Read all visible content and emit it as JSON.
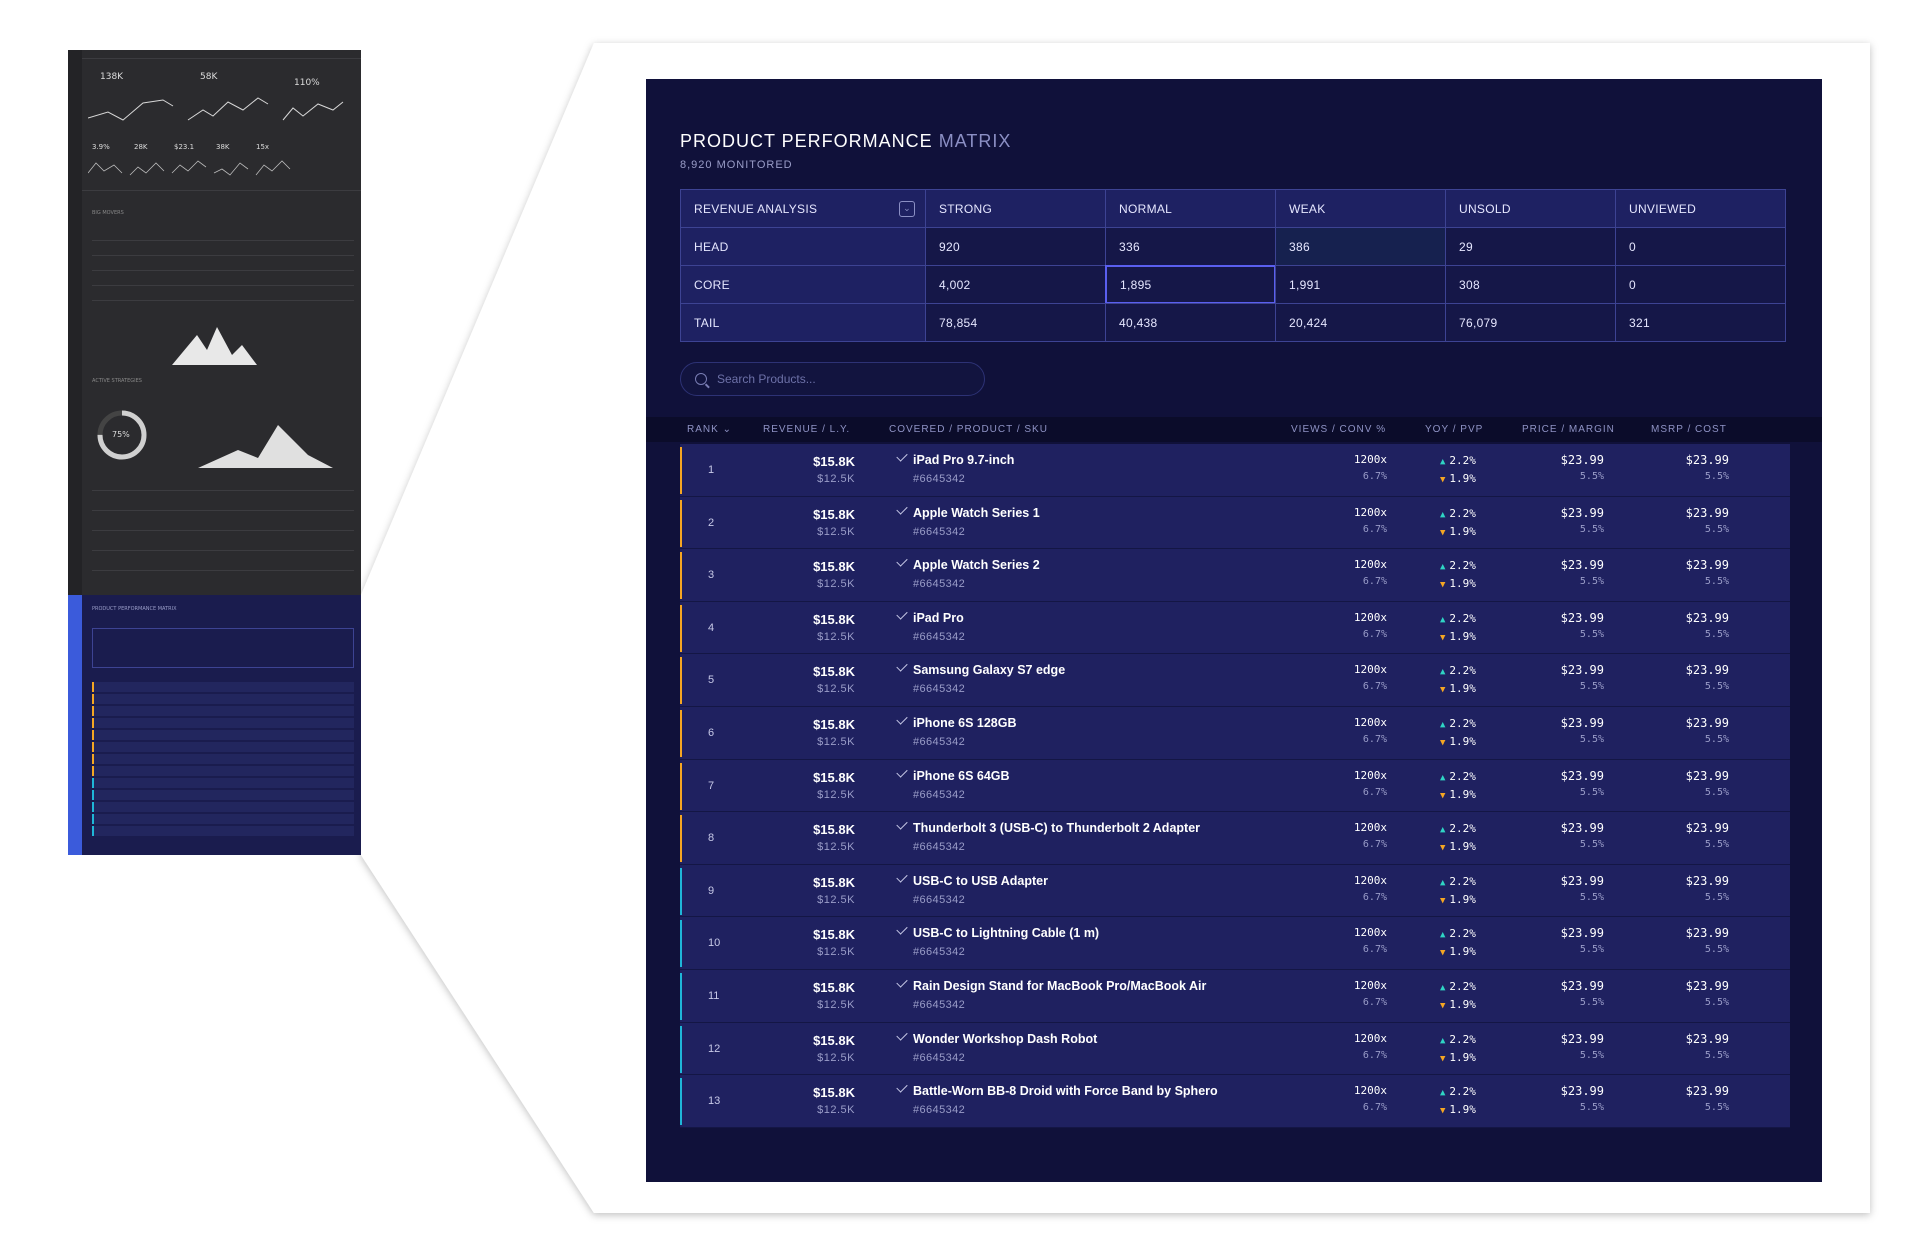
{
  "thumbnail": {
    "kpis": [
      "138K",
      "58K",
      "110%"
    ],
    "mini_kpis": [
      "3.9%",
      "28K",
      "$23.1",
      "38K",
      "15x"
    ],
    "section_big_movers": "BIG MOVERS",
    "section_active_strategies": "ACTIVE STRATEGIES",
    "donut_value": "75%",
    "section_product_performance": "PRODUCT PERFORMANCE MATRIX"
  },
  "matrix_panel": {
    "title_main": "PRODUCT PERFORMANCE",
    "title_dim": "MATRIX",
    "subtitle": "8,920 MONITORED",
    "header": [
      "REVENUE ANALYSIS",
      "STRONG",
      "NORMAL",
      "WEAK",
      "UNSOLD",
      "UNVIEWED"
    ],
    "rows": [
      {
        "label": "HEAD",
        "values": [
          "920",
          "336",
          "386",
          "29",
          "0"
        ]
      },
      {
        "label": "CORE",
        "values": [
          "4,002",
          "1,895",
          "1,991",
          "308",
          "0"
        ]
      },
      {
        "label": "TAIL",
        "values": [
          "78,854",
          "40,438",
          "20,424",
          "76,079",
          "321"
        ]
      }
    ],
    "colors": {
      "panel_bg": "#10113a",
      "selected_border": "#5a5ff0",
      "accent_orange": "#f5a623",
      "accent_cyan": "#1fb6d8"
    }
  },
  "search": {
    "placeholder": "Search Products..."
  },
  "table": {
    "headers": {
      "rank": "RANK",
      "revenue": "REVENUE / L.Y.",
      "product": "COVERED / PRODUCT / SKU",
      "views": "VIEWS / CONV %",
      "yoy": "YOY / PVP",
      "price": "PRICE / MARGIN",
      "msrp": "MSRP / COST"
    },
    "rows": [
      {
        "rank": "1",
        "revenue": "$15.8K",
        "ly": "$12.5K",
        "name": "iPad Pro 9.7-inch",
        "sku": "#6645342",
        "views": "1200x",
        "conv": "6.7%",
        "yoy": "2.2%",
        "pvp": "1.9%",
        "price": "$23.99",
        "margin": "5.5%",
        "msrp": "$23.99",
        "cost": "5.5%",
        "accent": "orange"
      },
      {
        "rank": "2",
        "revenue": "$15.8K",
        "ly": "$12.5K",
        "name": "Apple Watch Series 1",
        "sku": "#6645342",
        "views": "1200x",
        "conv": "6.7%",
        "yoy": "2.2%",
        "pvp": "1.9%",
        "price": "$23.99",
        "margin": "5.5%",
        "msrp": "$23.99",
        "cost": "5.5%",
        "accent": "orange"
      },
      {
        "rank": "3",
        "revenue": "$15.8K",
        "ly": "$12.5K",
        "name": "Apple Watch Series 2",
        "sku": "#6645342",
        "views": "1200x",
        "conv": "6.7%",
        "yoy": "2.2%",
        "pvp": "1.9%",
        "price": "$23.99",
        "margin": "5.5%",
        "msrp": "$23.99",
        "cost": "5.5%",
        "accent": "orange"
      },
      {
        "rank": "4",
        "revenue": "$15.8K",
        "ly": "$12.5K",
        "name": "iPad Pro",
        "sku": "#6645342",
        "views": "1200x",
        "conv": "6.7%",
        "yoy": "2.2%",
        "pvp": "1.9%",
        "price": "$23.99",
        "margin": "5.5%",
        "msrp": "$23.99",
        "cost": "5.5%",
        "accent": "orange"
      },
      {
        "rank": "5",
        "revenue": "$15.8K",
        "ly": "$12.5K",
        "name": "Samsung Galaxy S7 edge",
        "sku": "#6645342",
        "views": "1200x",
        "conv": "6.7%",
        "yoy": "2.2%",
        "pvp": "1.9%",
        "price": "$23.99",
        "margin": "5.5%",
        "msrp": "$23.99",
        "cost": "5.5%",
        "accent": "orange"
      },
      {
        "rank": "6",
        "revenue": "$15.8K",
        "ly": "$12.5K",
        "name": "iPhone 6S 128GB",
        "sku": "#6645342",
        "views": "1200x",
        "conv": "6.7%",
        "yoy": "2.2%",
        "pvp": "1.9%",
        "price": "$23.99",
        "margin": "5.5%",
        "msrp": "$23.99",
        "cost": "5.5%",
        "accent": "orange"
      },
      {
        "rank": "7",
        "revenue": "$15.8K",
        "ly": "$12.5K",
        "name": "iPhone 6S 64GB",
        "sku": "#6645342",
        "views": "1200x",
        "conv": "6.7%",
        "yoy": "2.2%",
        "pvp": "1.9%",
        "price": "$23.99",
        "margin": "5.5%",
        "msrp": "$23.99",
        "cost": "5.5%",
        "accent": "orange"
      },
      {
        "rank": "8",
        "revenue": "$15.8K",
        "ly": "$12.5K",
        "name": "Thunderbolt 3 (USB-C) to Thunderbolt 2 Adapter",
        "sku": "#6645342",
        "views": "1200x",
        "conv": "6.7%",
        "yoy": "2.2%",
        "pvp": "1.9%",
        "price": "$23.99",
        "margin": "5.5%",
        "msrp": "$23.99",
        "cost": "5.5%",
        "accent": "orange"
      },
      {
        "rank": "9",
        "revenue": "$15.8K",
        "ly": "$12.5K",
        "name": "USB-C to USB Adapter",
        "sku": "#6645342",
        "views": "1200x",
        "conv": "6.7%",
        "yoy": "2.2%",
        "pvp": "1.9%",
        "price": "$23.99",
        "margin": "5.5%",
        "msrp": "$23.99",
        "cost": "5.5%",
        "accent": "cyan"
      },
      {
        "rank": "10",
        "revenue": "$15.8K",
        "ly": "$12.5K",
        "name": "USB-C to Lightning Cable (1 m)",
        "sku": "#6645342",
        "views": "1200x",
        "conv": "6.7%",
        "yoy": "2.2%",
        "pvp": "1.9%",
        "price": "$23.99",
        "margin": "5.5%",
        "msrp": "$23.99",
        "cost": "5.5%",
        "accent": "cyan"
      },
      {
        "rank": "11",
        "revenue": "$15.8K",
        "ly": "$12.5K",
        "name": "Rain Design Stand for MacBook Pro/MacBook Air",
        "sku": "#6645342",
        "views": "1200x",
        "conv": "6.7%",
        "yoy": "2.2%",
        "pvp": "1.9%",
        "price": "$23.99",
        "margin": "5.5%",
        "msrp": "$23.99",
        "cost": "5.5%",
        "accent": "cyan"
      },
      {
        "rank": "12",
        "revenue": "$15.8K",
        "ly": "$12.5K",
        "name": "Wonder Workshop Dash Robot",
        "sku": "#6645342",
        "views": "1200x",
        "conv": "6.7%",
        "yoy": "2.2%",
        "pvp": "1.9%",
        "price": "$23.99",
        "margin": "5.5%",
        "msrp": "$23.99",
        "cost": "5.5%",
        "accent": "cyan"
      },
      {
        "rank": "13",
        "revenue": "$15.8K",
        "ly": "$12.5K",
        "name": "Battle-Worn BB-8 Droid with Force Band by Sphero",
        "sku": "#6645342",
        "views": "1200x",
        "conv": "6.7%",
        "yoy": "2.2%",
        "pvp": "1.9%",
        "price": "$23.99",
        "margin": "5.5%",
        "msrp": "$23.99",
        "cost": "5.5%",
        "accent": "cyan"
      }
    ]
  },
  "icons": {
    "search": "search-icon",
    "dropdown": "chevron-down-icon",
    "check": "check-icon",
    "trend_up": "triangle-up-icon",
    "trend_down": "triangle-down-icon",
    "sort": "sort-chevron-icon"
  }
}
